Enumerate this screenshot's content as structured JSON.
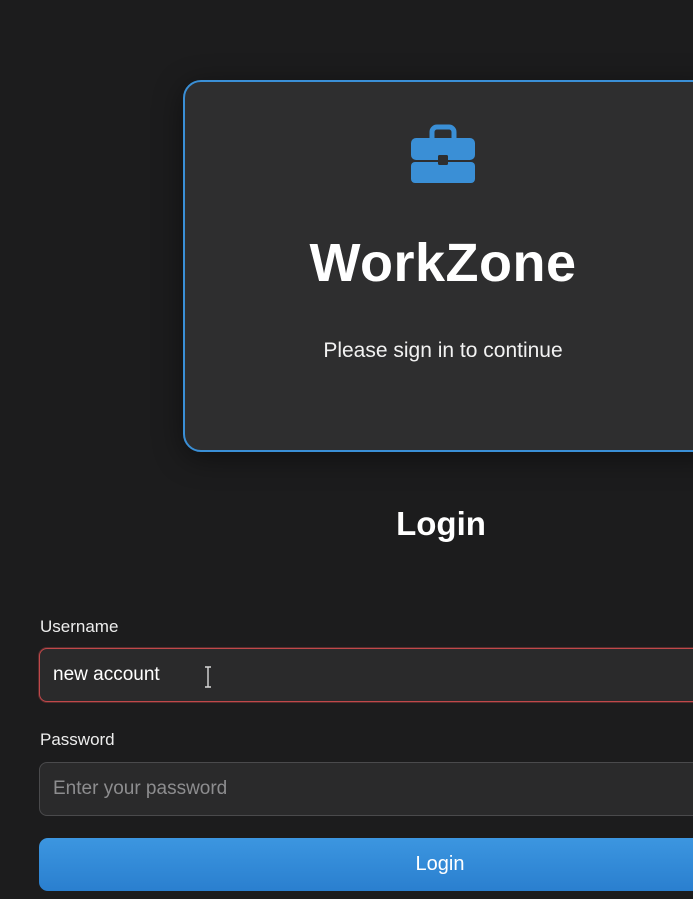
{
  "brand": {
    "icon": "briefcase-icon",
    "title": "WorkZone",
    "subtitle": "Please sign in to continue"
  },
  "form": {
    "title": "Login",
    "username": {
      "label": "Username",
      "value": "new account",
      "placeholder": ""
    },
    "password": {
      "label": "Password",
      "value": "",
      "placeholder": "Enter your password"
    },
    "submit_label": "Login"
  },
  "colors": {
    "accent": "#3a8fd6",
    "background": "#1c1c1d",
    "card": "#2e2e2f",
    "error_border": "#c0484a"
  }
}
